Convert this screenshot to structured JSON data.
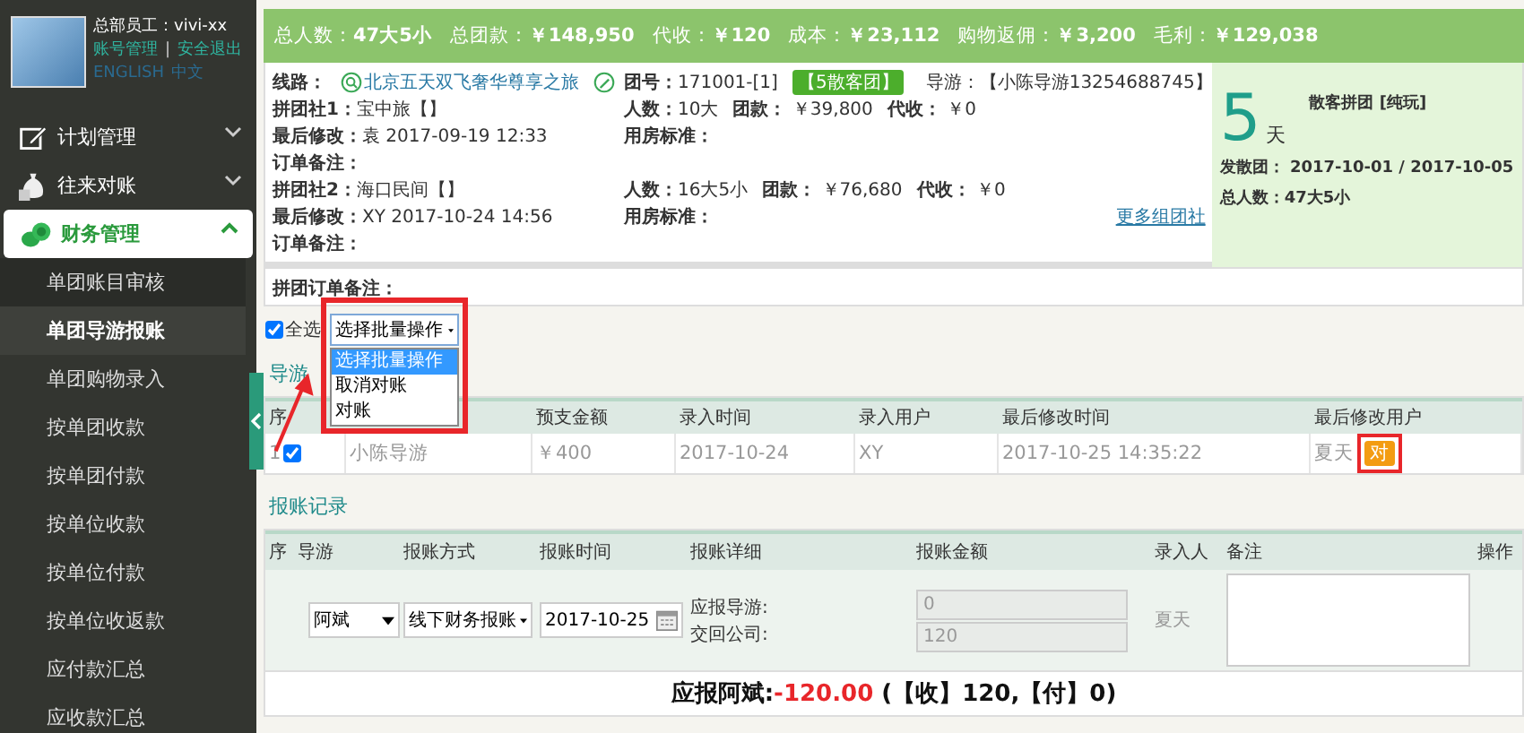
{
  "sidebar": {
    "user": "总部员工：vivi-xx",
    "links": [
      "账号管理",
      "安全退出"
    ],
    "link_separator": "|",
    "languages": [
      "ENGLISH",
      "中文"
    ],
    "menu": [
      {
        "label": "计划管理",
        "expanded": false,
        "selected": false
      },
      {
        "label": "往来对账",
        "expanded": false,
        "selected": false
      },
      {
        "label": "财务管理",
        "expanded": true,
        "selected": true
      }
    ],
    "submenu": [
      {
        "label": "单团账目审核",
        "selected": false
      },
      {
        "label": "单团导游报账",
        "selected": true
      },
      {
        "label": "单团购物录入",
        "selected": false
      },
      {
        "label": "按单团收款",
        "selected": false
      },
      {
        "label": "按单团付款",
        "selected": false
      },
      {
        "label": "按单位收款",
        "selected": false
      },
      {
        "label": "按单位付款",
        "selected": false
      },
      {
        "label": "按单位收返款",
        "selected": false
      },
      {
        "label": "应付款汇总",
        "selected": false
      },
      {
        "label": "应收款汇总",
        "selected": false
      }
    ]
  },
  "summary": [
    {
      "label": "总人数：",
      "value": "47大5小"
    },
    {
      "label": "总团款：",
      "value": "￥148,950"
    },
    {
      "label": "代收：",
      "value": "￥120"
    },
    {
      "label": "成本：",
      "value": "￥23,112"
    },
    {
      "label": "购物返佣：",
      "value": "￥3,200"
    },
    {
      "label": "毛利：",
      "value": "￥129,038"
    }
  ],
  "tour": {
    "route_label": "线路：",
    "route": "北京五天双飞奢华尊享之旅",
    "group_no_label": "团号：",
    "group_no": "171001-[1]",
    "type_badge": "【5散客团】",
    "guide_label": "导游：",
    "guide": "【小陈导游13254688745】",
    "agencies": [
      {
        "agency_label": "拼团社1：",
        "agency": "宝中旅【】",
        "people_label": "人数：",
        "people": "10大",
        "fee_label": "团款：",
        "fee": "￥39,800",
        "collect_label": "代收：",
        "collect": "￥0",
        "modified_label": "最后修改：",
        "modified": "袁 2017-09-19 12:33",
        "room_label": "用房标准：",
        "note_label": "订单备注："
      },
      {
        "agency_label": "拼团社2：",
        "agency": "海口民间【】",
        "people_label": "人数：",
        "people": "16大5小",
        "fee_label": "团款：",
        "fee": "￥76,680",
        "collect_label": "代收：",
        "collect": "￥0",
        "modified_label": "最后修改：",
        "modified": "XY 2017-10-24 14:56",
        "room_label": "用房标准：",
        "note_label": "订单备注："
      }
    ],
    "more_link": "更多组团社",
    "days": "5",
    "days_unit": "天",
    "tour_type": "散客拼团 [纯玩]",
    "dates_label": "发散团：",
    "dates": "2017-10-01 / 2017-10-05",
    "total_label": "总人数：",
    "total": "47大5小"
  },
  "order_note_label": "拼团订单备注：",
  "batch": {
    "select_all_label": "全选",
    "select_all_checked": true,
    "value": "选择批量操作",
    "open": true,
    "options": [
      {
        "label": "选择批量操作",
        "selected": true
      },
      {
        "label": "取消对账",
        "selected": false
      },
      {
        "label": "对账",
        "selected": false
      }
    ]
  },
  "guide_section": {
    "title": "导游",
    "columns": [
      "序",
      "预支金额",
      "录入时间",
      "录入用户",
      "最后修改时间",
      "最后修改用户"
    ],
    "rows": [
      {
        "no": "1",
        "checked": true,
        "guide": "小陈导游",
        "advance": "￥400",
        "entry_time": "2017-10-24",
        "entry_user": "XY",
        "modified_time": "2017-10-25 14:35:22",
        "modified_user": "夏天",
        "status_badge": "对"
      }
    ]
  },
  "records": {
    "title": "报账记录",
    "columns": [
      "序",
      "导游",
      "报账方式",
      "报账时间",
      "报账详细",
      "报账金额",
      "录入人",
      "备注",
      "操作"
    ],
    "row": {
      "guide": "阿斌",
      "method": "线下财务报账",
      "date": "2017-10-25",
      "detail_labels": [
        "应报导游:",
        "交回公司:"
      ],
      "amounts": [
        "0",
        "120"
      ],
      "entry_user": "夏天"
    },
    "balance_label": "应报阿斌:",
    "balance": "-120.00",
    "balance_detail": "(【收】120,【付】0)"
  }
}
